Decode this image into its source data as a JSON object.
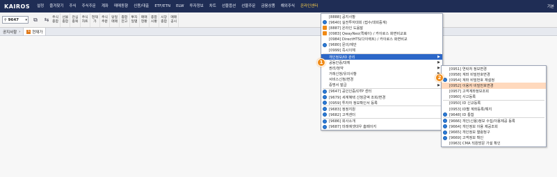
{
  "menubar": {
    "logo": "KAIROS",
    "items": [
      "설정",
      "즐겨찾기",
      "주식",
      "주식주문",
      "계좌",
      "매매동향",
      "신용/대출",
      "ETF/ETN",
      "ELW",
      "투자정보",
      "차트",
      "선물옵션",
      "선물주문",
      "금융상품",
      "해외주식",
      "온라인센터"
    ],
    "right_label": "기본"
  },
  "toolbar": {
    "code": "9647",
    "buttons": [
      "주식\n종합",
      "선물\n종합",
      "관심\n종목",
      "주식\n차트",
      "현재\n가",
      "주식\n주문",
      "당일\n매매",
      "종합\n잔고",
      "투자\n일별",
      "매매\n현황",
      "종합\n시황",
      "시장\n종합",
      "매매\n공시"
    ]
  },
  "tabs": [
    {
      "label": "공지사항"
    },
    {
      "label": "현재가",
      "badge": "S"
    }
  ],
  "menu1": {
    "items": [
      {
        "text": "[8888] 공지사항",
        "icon": "none"
      },
      {
        "text": "[9640] 실전투자대회 (접수/대회중계)",
        "icon": "ie-icon"
      },
      {
        "text": "[8887] 온라인 도움말",
        "icon": "app-icon"
      },
      {
        "text": "[0983] QwayNeo(퀵웨이) / 카이로스 화면비교표",
        "icon": "app-icon"
      },
      {
        "text": "[0984] DirectHTS(다이렉트) / 카이로스 화면비교",
        "icon": "none"
      },
      {
        "text": "[9680] 문의/제안",
        "icon": "ie-icon"
      },
      {
        "text": "[0999] 즉시이체",
        "icon": "none"
      },
      {
        "text": "개인정보/ID 관리",
        "icon": "none",
        "submenu": true,
        "highlighted": true
      },
      {
        "text": "공동인증/대체",
        "icon": "none",
        "submenu": true
      },
      {
        "text": "권리/청약",
        "icon": "none",
        "submenu": true
      },
      {
        "text": "거래신청/유의사항",
        "icon": "none",
        "submenu": true
      },
      {
        "text": "서비스신청/변경",
        "icon": "none",
        "submenu": true
      },
      {
        "text": "증명서 발급",
        "icon": "none",
        "submenu": true
      },
      {
        "text": "[9647] 공인인증/OTP 센터",
        "icon": "ie-icon"
      },
      {
        "text": "[9679] 세계혜택 신청금액 조회/변경",
        "icon": "ie-icon"
      },
      {
        "text": "[0959] 투자자 정보확인서 등록",
        "icon": "ie-icon"
      },
      {
        "text": "[9683] 정정지원",
        "icon": "ie-icon"
      },
      {
        "text": "[9682] 고객센터",
        "icon": "ie-icon"
      },
      {
        "text": "[9686] 회사소개",
        "icon": "ie-icon"
      },
      {
        "text": "[9687] 미래에셋대우 홈페이지",
        "icon": "ie-icon"
      }
    ]
  },
  "menu2": {
    "items": [
      {
        "text": "[0951] 연락처 정보변경",
        "icon": "none"
      },
      {
        "text": "[0958] 계좌 비밀번호변경",
        "icon": "none"
      },
      {
        "text": "[0954] 계좌 비밀번호 재설정",
        "icon": "ie-icon"
      },
      {
        "text": "[0952] 이용자 비밀번호변경",
        "icon": "none",
        "hovered": true
      },
      {
        "text": "[0957] 고객계좌정보조회",
        "icon": "none"
      },
      {
        "text": "[0960] 사고등록",
        "icon": "none"
      },
      {
        "text": "[0950] ID 신규등록",
        "icon": "none"
      },
      {
        "text": "[0953] ID별 계좌등록/해지",
        "icon": "none"
      },
      {
        "text": "[9648] ID 통합",
        "icon": "ie-icon"
      },
      {
        "text": "[9666] 개인(신용)정보 수집/이용제공 동록",
        "icon": "ie-icon"
      },
      {
        "text": "[9664] 개인정보 이용 제공조회",
        "icon": "ie-icon"
      },
      {
        "text": "[9665] 개인정보 열람청구",
        "icon": "ie-icon"
      },
      {
        "text": "[9669] 고객정보 확인",
        "icon": "ie-icon"
      },
      {
        "text": "[0963] CMA 직원방문 가설 확인",
        "icon": "none"
      }
    ]
  },
  "callouts": [
    "1",
    "2"
  ],
  "colors": {
    "menubar": "#1f2d55",
    "highlight": "#2c67c8",
    "hover": "#ffd9bd",
    "callout": "#f08a16"
  }
}
